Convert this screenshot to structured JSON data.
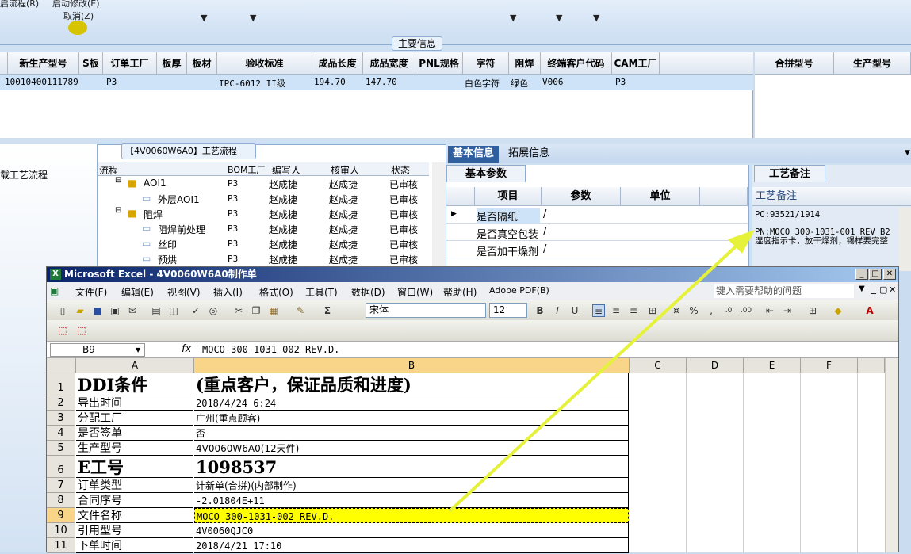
{
  "topbar": {
    "menu1": "启流程(R)",
    "menu2": "启动修改(E)",
    "menu3": "取消(Z)"
  },
  "main_info_label": "主要信息",
  "grid1": {
    "headers": [
      "新生产型号",
      "S板",
      "订单工厂",
      "板厚",
      "板材",
      "验收标准",
      "成品长度",
      "成品宽度",
      "PNL规格",
      "字符",
      "阻焊",
      "终端客户代码",
      "CAM工厂"
    ],
    "row": {
      "model": "10010400111789",
      "factory": "P3",
      "standard": "IPC-6012 II级",
      "length": "194.70",
      "width": "147.70",
      "char": "白色字符",
      "mask": "绿色",
      "customer": "V006",
      "cam": "P3"
    }
  },
  "grid2": {
    "headers": [
      "合拼型号",
      "生产型号"
    ]
  },
  "left_panel": {
    "label": "载工艺流程"
  },
  "process": {
    "title": "【4V0060W6A0】工艺流程",
    "headers": [
      "流程",
      "BOM工厂",
      "编写人",
      "核审人",
      "状态"
    ],
    "rows": [
      {
        "name": "AOI1",
        "bom": "P3",
        "writer": "赵成捷",
        "reviewer": "赵成捷",
        "status": "已审核"
      },
      {
        "name": "外层AOI1",
        "bom": "P3",
        "writer": "赵成捷",
        "reviewer": "赵成捷",
        "status": "已审核"
      },
      {
        "name": "阻焊",
        "bom": "P3",
        "writer": "赵成捷",
        "reviewer": "赵成捷",
        "status": "已审核"
      },
      {
        "name": "阻焊前处理",
        "bom": "P3",
        "writer": "赵成捷",
        "reviewer": "赵成捷",
        "status": "已审核"
      },
      {
        "name": "丝印",
        "bom": "P3",
        "writer": "赵成捷",
        "reviewer": "赵成捷",
        "status": "已审核"
      },
      {
        "name": "预烘",
        "bom": "P3",
        "writer": "赵成捷",
        "reviewer": "赵成捷",
        "status": "已审核"
      }
    ]
  },
  "right_tabs": [
    "基本信息",
    "拓展信息"
  ],
  "basic_params": {
    "tab": "基本参数",
    "headers": [
      "项目",
      "参数",
      "单位"
    ],
    "rows": [
      {
        "item": "是否隔纸",
        "value": "/"
      },
      {
        "item": "是否真空包装",
        "value": "/"
      },
      {
        "item": "是否加干燥剂",
        "value": "/"
      }
    ]
  },
  "notes": {
    "tab": "工艺备注",
    "header": "工艺备注",
    "po": "PO:93521/1914",
    "pn": "PN:MOCO 300-1031-001 REV B2",
    "desc": "湿度指示卡，放干燥剂，锡样要完整"
  },
  "excel": {
    "title": "Microsoft Excel - 4V0060W6A0制作单",
    "menus": [
      "文件(F)",
      "编辑(E)",
      "视图(V)",
      "插入(I)",
      "格式(O)",
      "工具(T)",
      "数据(D)",
      "窗口(W)",
      "帮助(H)",
      "Adobe PDF(B)"
    ],
    "help_placeholder": "键入需要帮助的问题",
    "font": "宋体",
    "font_size": "12",
    "namebox": "B9",
    "fx": "fx",
    "formula": "MOCO 300-1031-002 REV.D.",
    "columns": [
      "A",
      "B",
      "C",
      "D",
      "E",
      "F"
    ],
    "rows": [
      {
        "n": "1",
        "a": "DDI条件",
        "b": "(重点客户，保证品质和进度)"
      },
      {
        "n": "2",
        "a": "导出时间",
        "b": "2018/4/24 6:24"
      },
      {
        "n": "3",
        "a": "分配工厂",
        "b": "广州(重点顾客)"
      },
      {
        "n": "4",
        "a": "是否签单",
        "b": "否"
      },
      {
        "n": "5",
        "a": "生产型号",
        "b": "4V0060W6A0(12天件)"
      },
      {
        "n": "6",
        "a": "E工号",
        "b": "1098537"
      },
      {
        "n": "7",
        "a": "订单类型",
        "b": "计新单(合拼)(内部制作)"
      },
      {
        "n": "8",
        "a": "合同序号",
        "b": "-2.01804E+11"
      },
      {
        "n": "9",
        "a": "文件名称",
        "b": "MOCO 300-1031-002 REV.D."
      },
      {
        "n": "10",
        "a": "引用型号",
        "b": "4V0060QJC0"
      },
      {
        "n": "11",
        "a": "下单时间",
        "b": "2018/4/21 17:10"
      }
    ],
    "highlight_color": "#ffff00"
  },
  "annotation_color": "#e6f23a"
}
